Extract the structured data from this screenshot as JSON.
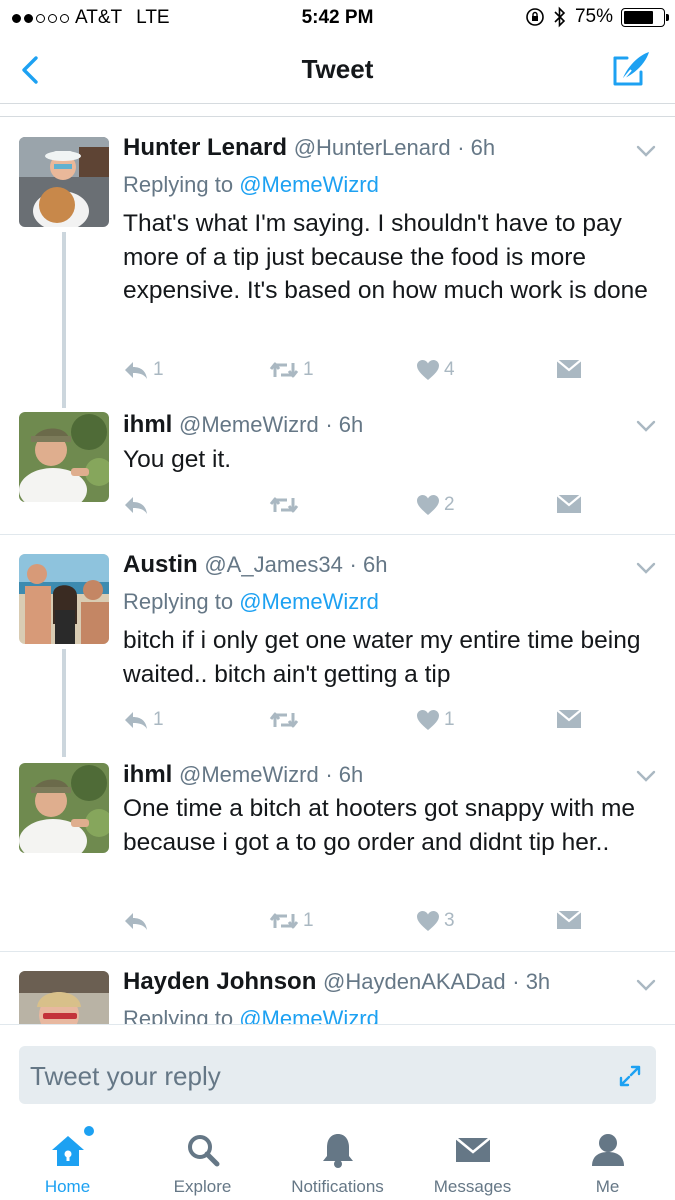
{
  "status_bar": {
    "carrier": "AT&T",
    "network": "LTE",
    "time": "5:42 PM",
    "battery": "75%",
    "battery_level": 0.75,
    "signal_bars_filled": 2,
    "signal_bars_total": 5,
    "icons": [
      "orientation-lock-icon",
      "bluetooth-icon",
      "battery-icon"
    ]
  },
  "nav": {
    "title": "Tweet",
    "back_icon": "chevron-left-icon",
    "compose_icon": "compose-tweet-icon"
  },
  "tweets": [
    {
      "name": "Hunter Lenard",
      "handle": "@HunterLenard",
      "time": "· 6h",
      "replying_prefix": "Replying to",
      "replying_to": "@MemeWizrd",
      "text": "That's what I'm saying. I shouldn't have to pay more of a tip just because the food is more expensive. It's based on how much work is done",
      "reply_count": "1",
      "retweet_count": "1",
      "like_count": "4"
    },
    {
      "name": "ihml",
      "handle": "@MemeWizrd",
      "time": "· 6h",
      "text": "You get it.",
      "reply_count": "",
      "retweet_count": "",
      "like_count": "2"
    },
    {
      "name": "Austin",
      "handle": "@A_James34",
      "time": "· 6h",
      "replying_prefix": "Replying to",
      "replying_to": "@MemeWizrd",
      "text": "bitch if i only get one water my entire time being waited.. bitch ain't getting a tip",
      "reply_count": "1",
      "retweet_count": "",
      "like_count": "1"
    },
    {
      "name": "ihml",
      "handle": "@MemeWizrd",
      "time": "· 6h",
      "text": "One time a bitch at hooters got snappy with me because i got a to go order and didnt tip her..",
      "reply_count": "",
      "retweet_count": "1",
      "like_count": "3"
    },
    {
      "name": "Hayden Johnson",
      "handle": "@HaydenAKADad",
      "time": "· 3h",
      "replying_prefix": "Replying to",
      "replying_to": "@MemeWizrd"
    }
  ],
  "reply_box": {
    "placeholder": "Tweet your reply",
    "expand_icon": "expand-icon"
  },
  "tabs": [
    {
      "label": "Home",
      "icon": "home-icon",
      "active": true
    },
    {
      "label": "Explore",
      "icon": "search-icon",
      "active": false
    },
    {
      "label": "Notifications",
      "icon": "bell-icon",
      "active": false
    },
    {
      "label": "Messages",
      "icon": "envelope-icon",
      "active": false
    },
    {
      "label": "Me",
      "icon": "person-icon",
      "active": false
    }
  ],
  "colors": {
    "accent": "#1da1f2",
    "text": "#14171a",
    "secondary_text": "#657786",
    "action_gray": "#aab8c2",
    "divider": "#e1e8ed"
  }
}
